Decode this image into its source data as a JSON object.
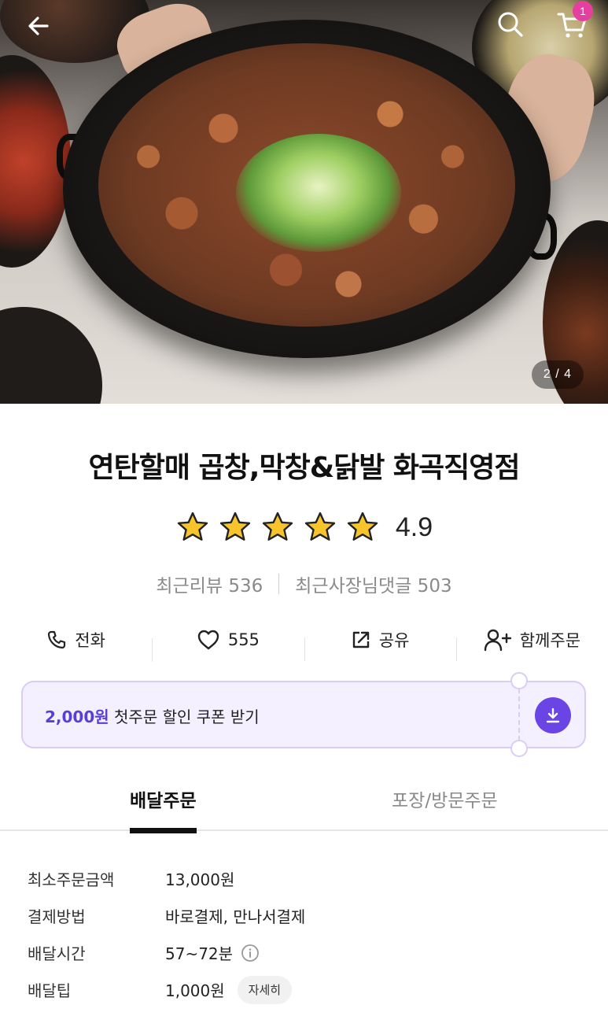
{
  "hero": {
    "image_counter": "2 / 4",
    "cart_count": "1"
  },
  "icons": {
    "back": "arrow-left-icon",
    "search": "search-icon",
    "cart": "cart-icon",
    "star": "star-icon",
    "phone": "phone-icon",
    "heart": "heart-icon",
    "share": "share-icon",
    "add_person": "add-person-icon",
    "download": "download-icon",
    "info": "info-icon"
  },
  "store": {
    "name": "연탄할매 곱창,막창&닭발 화곡직영점",
    "rating": "4.9",
    "star_count": 5,
    "recent_reviews_label": "최근리뷰 536",
    "recent_owner_replies_label": "최근사장님댓글 503"
  },
  "actions": {
    "call": "전화",
    "like_count": "555",
    "share": "공유",
    "group_order": "함께주문"
  },
  "coupon": {
    "amount": "2,000원",
    "text": " 첫주문 할인 쿠폰 받기"
  },
  "tabs": [
    {
      "label": "배달주문",
      "active": true
    },
    {
      "label": "포장/방문주문",
      "active": false
    }
  ],
  "delivery_info": {
    "min_order_label": "최소주문금액",
    "min_order_value": "13,000원",
    "payment_label": "결제방법",
    "payment_value": "바로결제, 만나서결제",
    "time_label": "배달시간",
    "time_value": "57~72분",
    "tip_label": "배달팁",
    "tip_value": "1,000원",
    "tip_detail_button": "자세히"
  },
  "colors": {
    "accent_purple": "#6b44e6",
    "coupon_bg": "#f4f0ff",
    "badge_pink": "#e53f9f",
    "star_yellow": "#f7c52b"
  }
}
